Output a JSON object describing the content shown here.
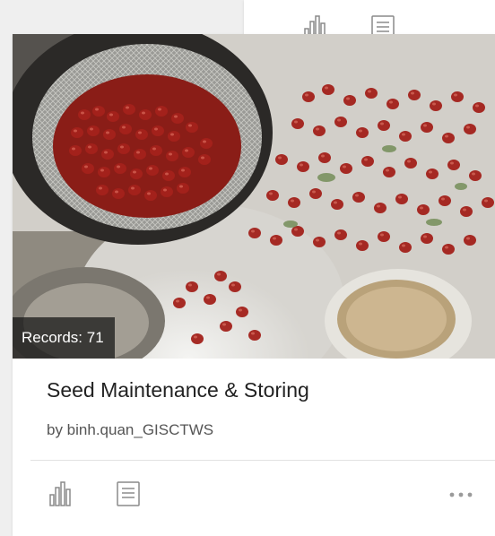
{
  "top_card": {
    "icons": [
      "chart-icon",
      "details-icon"
    ]
  },
  "card": {
    "records_badge": "Records: 71",
    "title": "Seed Maintenance & Storing",
    "owner": "by binh.quan_GISCTWS",
    "icons": [
      "chart-icon",
      "details-icon",
      "more-icon"
    ]
  },
  "colors": {
    "background": "#efefef",
    "card": "#ffffff",
    "icon": "#8a8a8a",
    "title_text": "#222222",
    "owner_text": "#555555"
  }
}
